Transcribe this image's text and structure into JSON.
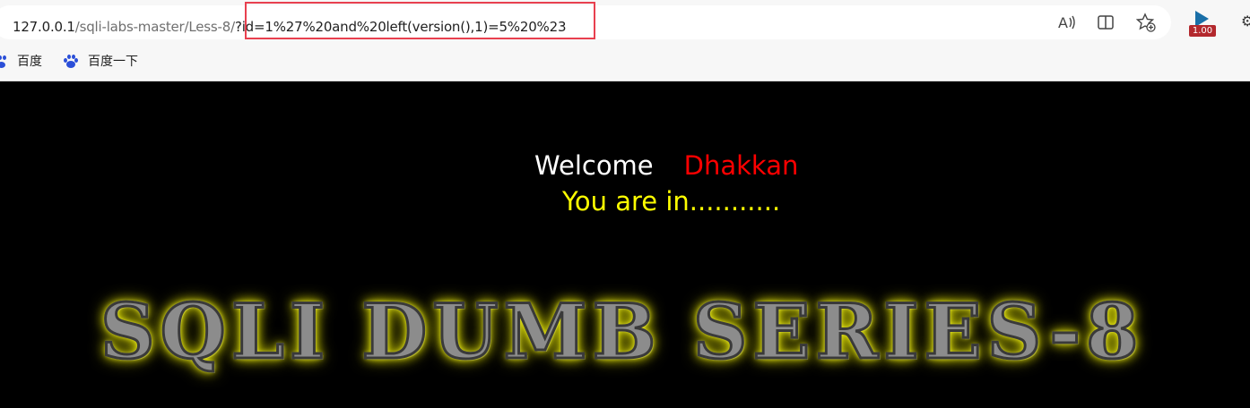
{
  "browser": {
    "url": {
      "host": "127.0.0.1",
      "path": "/sqli-labs-master/Less-8/",
      "query": "?id=1%27%20and%20left(version(),1)=5%20%23"
    },
    "toolbar_icons": [
      "read-aloud-icon",
      "split-screen-icon",
      "favorite-add-icon"
    ],
    "extension_badge": "1.00",
    "bookmarks": [
      {
        "label": "百度",
        "icon": "baidu-paw-icon"
      },
      {
        "label": "百度一下",
        "icon": "baidu-paw-icon"
      }
    ],
    "colors": {
      "highlight": "#e8404f",
      "bookmark_icon": "#2b4fd8"
    }
  },
  "page": {
    "welcome": "Welcome",
    "name": "Dhakkan",
    "status": "You are in...........",
    "banner": "SQLI DUMB SERIES-8",
    "colors": {
      "background": "#000000",
      "welcome": "#ffffff",
      "name": "#ff0000",
      "status": "#ffff00",
      "banner_glow": "#ffff00"
    }
  }
}
